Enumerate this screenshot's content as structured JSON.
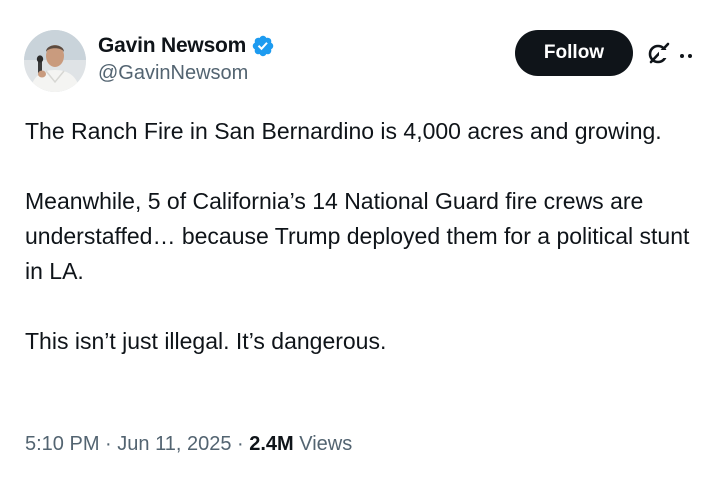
{
  "author": {
    "display_name": "Gavin Newsom",
    "handle": "@GavinNewsom",
    "verified_badge_color": "#1d9bf0",
    "avatar": "avatar-photo"
  },
  "actions": {
    "follow_label": "Follow",
    "grok_icon": "grok-icon",
    "more_icon": "more-icon"
  },
  "tweet": {
    "paragraphs": [
      "The Ranch Fire in San Bernardino is 4,000 acres and growing.",
      "Meanwhile, 5 of California’s 14 National Guard fire crews are understaffed… because Trump deployed them for a political stunt in LA.",
      "This isn’t just illegal. It’s dangerous."
    ]
  },
  "meta": {
    "time": "5:10 PM",
    "separator": " · ",
    "date": "Jun 11, 2025",
    "views_count": "2.4M",
    "views_label": "Views"
  },
  "colors": {
    "text_primary": "#0f1419",
    "text_secondary": "#536471",
    "button_bg": "#0f1419",
    "button_text": "#ffffff"
  }
}
